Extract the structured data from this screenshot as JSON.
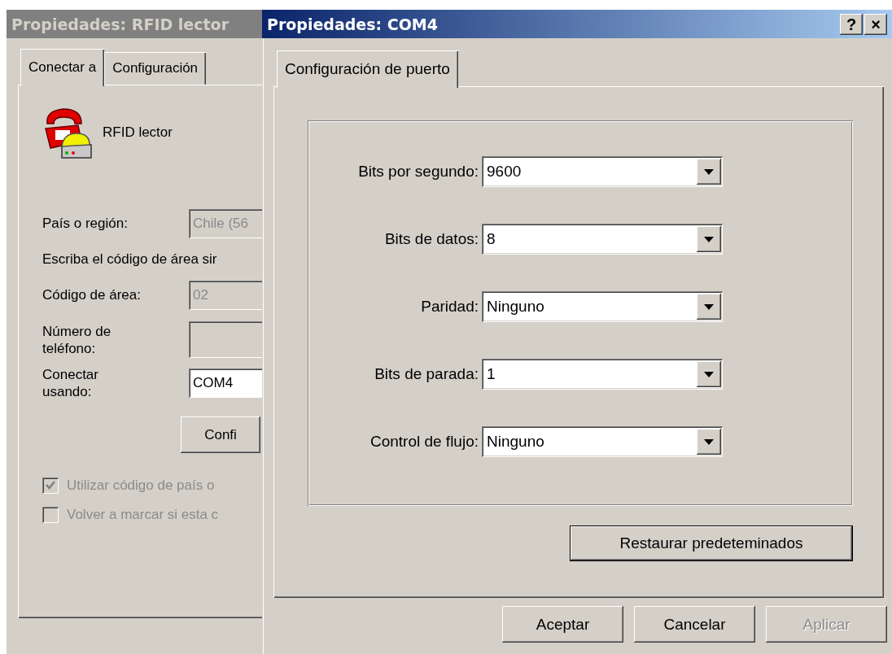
{
  "back_window": {
    "title": "Propiedades: RFID lector",
    "active": false,
    "tabs": [
      {
        "label": "Conectar a",
        "selected": true
      },
      {
        "label": "Configuración",
        "selected": false
      }
    ],
    "entry_name": "RFID lector",
    "country": {
      "label": "País o región:",
      "value": "Chile (56",
      "disabled": true
    },
    "area_hint": "Escriba el código de área sir",
    "area_code": {
      "label": "Código de área:",
      "value": "02",
      "disabled": true
    },
    "phone": {
      "label": "Número de teléfono:",
      "disabled": true
    },
    "connect_using": {
      "label": "Conectar usando:",
      "value": "COM4",
      "disabled": false
    },
    "configure_button": "Confi",
    "checkboxes": [
      {
        "label": "Utilizar código de país o",
        "checked": true,
        "disabled": true
      },
      {
        "label": "Volver a marcar si esta c",
        "checked": false,
        "disabled": true
      }
    ]
  },
  "front_window": {
    "title": "Propiedades: COM4",
    "active": true,
    "help_button": "?",
    "close_button": "×",
    "tabs": [
      {
        "label": "Configuración de puerto",
        "selected": true
      }
    ],
    "settings": [
      {
        "label": "Bits por segundo:",
        "value": "9600"
      },
      {
        "label": "Bits de datos:",
        "value": "8"
      },
      {
        "label": "Paridad:",
        "value": "Ninguno"
      },
      {
        "label": "Bits de parada:",
        "value": "1"
      },
      {
        "label": "Control de flujo:",
        "value": "Ninguno"
      }
    ],
    "restore_button": "Restaurar predeteminados",
    "buttons": [
      {
        "label": "Aceptar",
        "disabled": false
      },
      {
        "label": "Cancelar",
        "disabled": false
      },
      {
        "label": "Aplicar",
        "disabled": true
      }
    ]
  }
}
